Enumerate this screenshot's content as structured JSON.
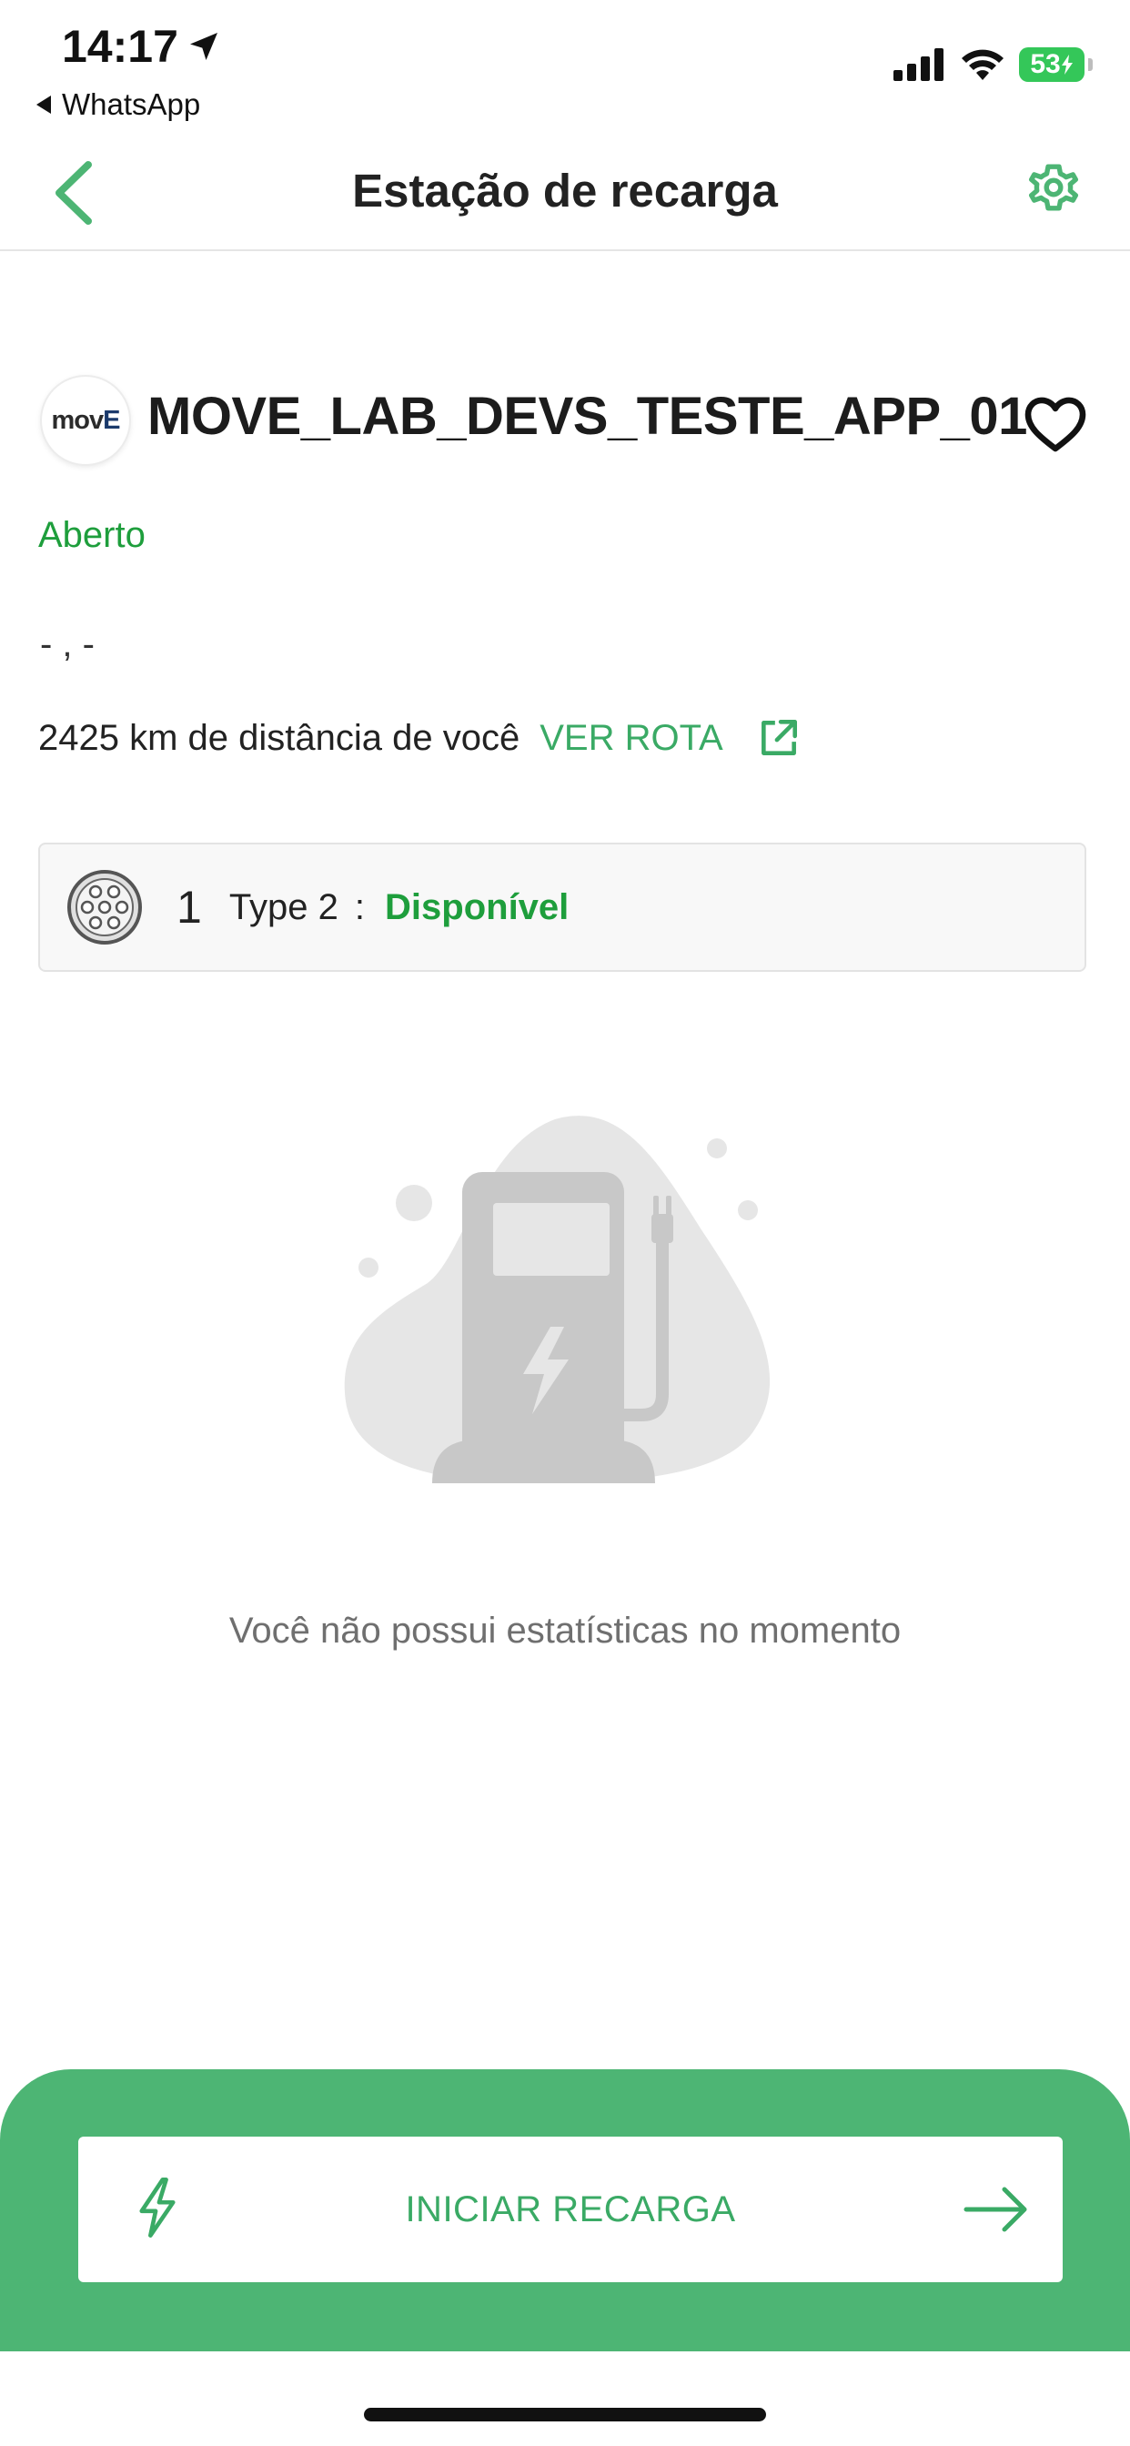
{
  "status_bar": {
    "time": "14:17",
    "back_app": "WhatsApp",
    "battery": "53"
  },
  "header": {
    "title": "Estação de recarga"
  },
  "station": {
    "logo_text_main": "mov",
    "logo_text_accent": "E",
    "name": "MOVE_LAB_DEVS_TESTE_APP_01",
    "status": "Aberto",
    "address": "- , -",
    "distance": "2425 km de distância de você",
    "route_label": "VER ROTA"
  },
  "connector": {
    "count": "1",
    "type": "Type 2",
    "separator": ":",
    "status": "Disponível"
  },
  "empty_state": {
    "message": "Você não possui estatísticas no momento"
  },
  "footer": {
    "button_label": "INICIAR RECARGA"
  },
  "colors": {
    "accent_green": "#4db574",
    "text_green": "#1e9e3c",
    "link_green": "#3aaa65",
    "illustration_gray": "#c8c8c8",
    "blob_gray": "#e6e6e6"
  },
  "icons": {
    "back": "chevron-left-icon",
    "settings": "gear-icon",
    "favorite": "heart-outline-icon",
    "route": "external-link-icon",
    "connector": "type2-connector-icon",
    "bolt": "bolt-icon",
    "arrow": "arrow-right-icon"
  }
}
